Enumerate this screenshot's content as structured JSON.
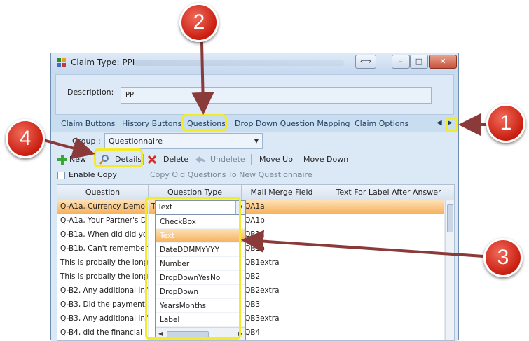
{
  "window": {
    "title": "Claim Type: PPI",
    "buttons": [
      "⟺",
      "–",
      "□",
      "✕"
    ]
  },
  "description": {
    "label": "Description:",
    "value": "PPI"
  },
  "tabs": [
    "Claim Buttons",
    "History Buttons",
    "Questions",
    "Drop Down Question Mapping",
    "Claim Options"
  ],
  "group": {
    "label": "Group :",
    "value": "Questionnaire"
  },
  "toolbar": {
    "new_label": "New",
    "details_label": "Details",
    "delete_label": "Delete",
    "undelete_label": "Undelete",
    "move_up_label": "Move Up",
    "move_down_label": "Move Down"
  },
  "enable_copy_label": "Enable Copy",
  "copy_label": "Copy Old Questions To New Questionnaire",
  "grid": {
    "columns": [
      "Question",
      "Question Type",
      "Mail Merge Field",
      "Text For Label After Answer"
    ],
    "rows": [
      {
        "question": "Q-A1a, Currency Demo",
        "type": "Text",
        "field": "QA1a"
      },
      {
        "question": "Q-A1a, Your Partner's D",
        "type": "",
        "field": "QA1b"
      },
      {
        "question": "Q-B1a, When did did yo",
        "type": "",
        "field": "QB1a"
      },
      {
        "question": "Q-B1b, Can't remember",
        "type": "",
        "field": "QB1b"
      },
      {
        "question": "This is probally the long",
        "type": "",
        "field": "QB1extra"
      },
      {
        "question": "This is probally the long",
        "type": "",
        "field": "QB2"
      },
      {
        "question": "Q-B2, Any additional inf",
        "type": "",
        "field": "QB2extra"
      },
      {
        "question": "Q-B3, Did the payment",
        "type": "",
        "field": "QB3"
      },
      {
        "question": "Q-B3, Any additional inf",
        "type": "",
        "field": "QB3extra"
      },
      {
        "question": "Q-B4, did the financial",
        "type": "",
        "field": "QB4"
      }
    ]
  },
  "dropdown": {
    "selected": "Text",
    "options": [
      "CheckBox",
      "Text",
      "DateDDMMYYYY",
      "Number",
      "DropDownYesNo",
      "DropDown",
      "YearsMonths",
      "Label"
    ],
    "highlighted": "Text"
  },
  "callouts": [
    "1",
    "2",
    "3",
    "4"
  ],
  "colors": {
    "callout_red": "#c81e10",
    "highlight_yellow": "#f2ea2a",
    "arrow": "#8b3a3a",
    "selection_orange": "#f6b25c"
  }
}
